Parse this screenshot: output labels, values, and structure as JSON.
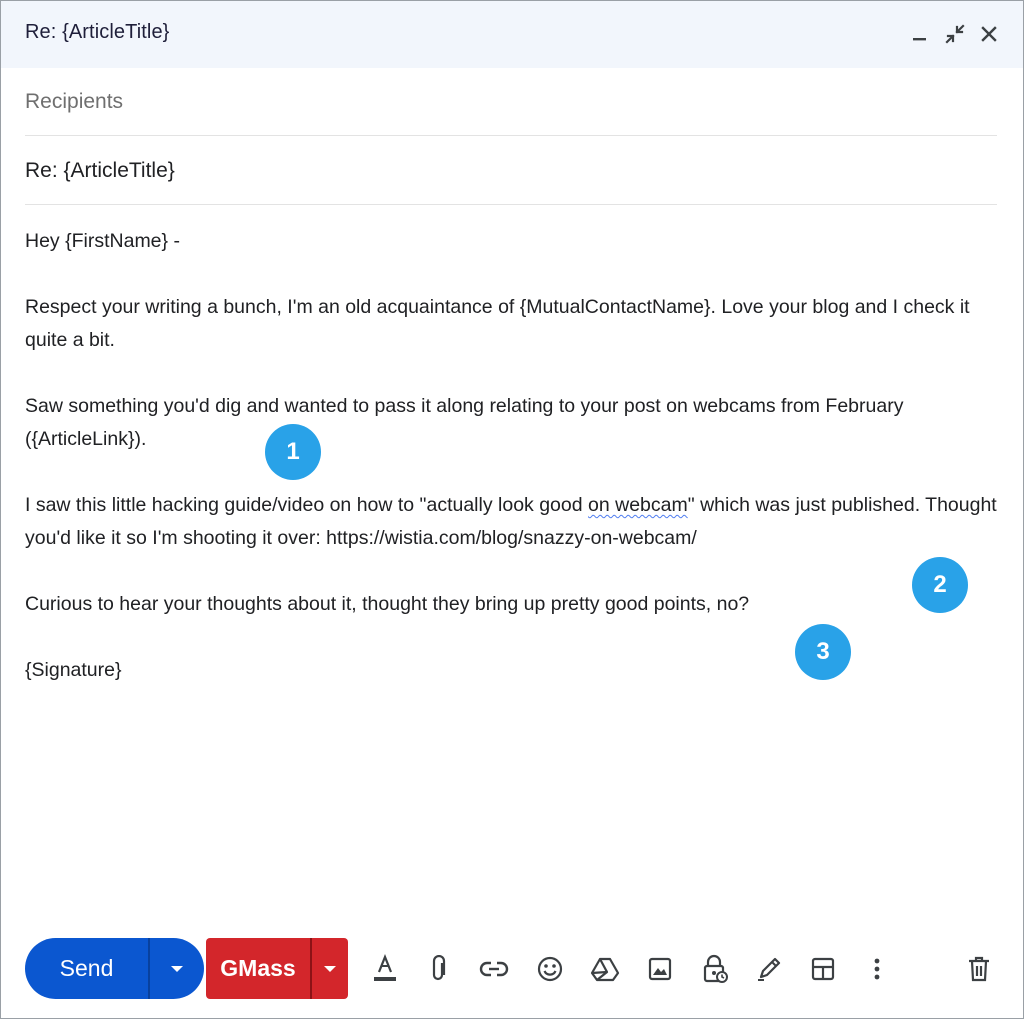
{
  "window": {
    "title": "Re: {ArticleTitle}",
    "controls": [
      "minimize-icon",
      "exit-fullscreen-icon",
      "close-icon"
    ]
  },
  "compose": {
    "recipients_placeholder": "Recipients",
    "subject": "Re: {ArticleTitle}",
    "body": {
      "greeting": "Hey {FirstName} -",
      "p1": "Respect your writing a bunch, I'm an old acquaintance of {MutualContactName}. Love your blog and I check it quite a bit.",
      "p2": "Saw something you'd dig and wanted to pass it along relating to your post on webcams from February ({ArticleLink}).",
      "p3_before": "I saw this little hacking guide/video on how to \"actually look good ",
      "p3_flagged": "on webcam",
      "p3_after": "\" which was just published. Thought you'd like it so I'm shooting it over: https://wistia.com/blog/snazzy-on-webcam/",
      "p4": "Curious to hear your thoughts about it, thought they bring up pretty good points, no?",
      "signature": "{Signature}"
    }
  },
  "markers": [
    "1",
    "2",
    "3"
  ],
  "toolbar": {
    "send_label": "Send",
    "gmass_label": "GMass",
    "icons": [
      "text-format-icon",
      "attach-icon",
      "link-icon",
      "emoji-icon",
      "drive-icon",
      "photo-icon",
      "confidential-mode-icon",
      "signature-icon",
      "layout-icon",
      "more-options-icon",
      "delete-icon"
    ]
  },
  "colors": {
    "send_button": "#0b57d0",
    "gmass_button": "#d3262b",
    "marker": "#29a2e8",
    "header_background": "#f2f6fc",
    "spellcheck_underline": "#4f7df0"
  }
}
